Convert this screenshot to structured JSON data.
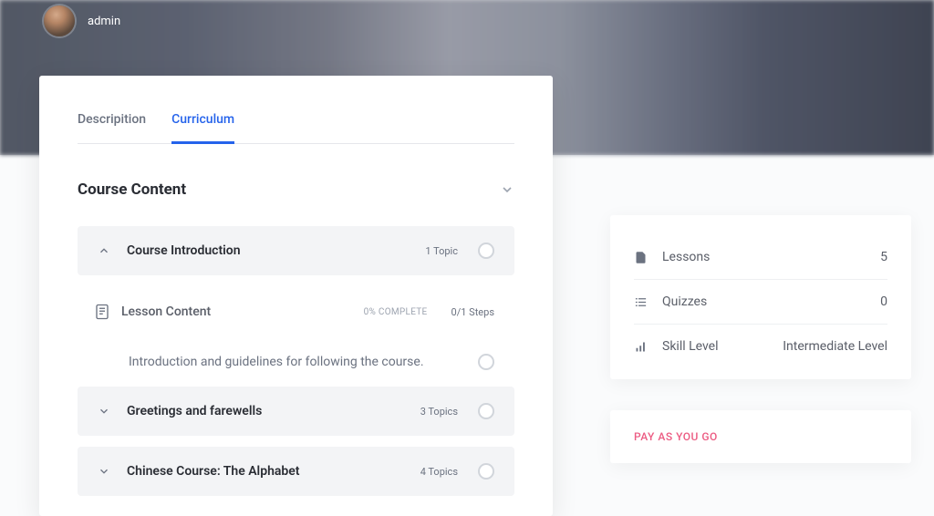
{
  "author": {
    "name": "admin"
  },
  "tabs": {
    "description": "Descripition",
    "curriculum": "Curriculum"
  },
  "course_content": {
    "heading": "Course Content",
    "sections": [
      {
        "title": "Course Introduction",
        "meta": "1 Topic",
        "expanded": true
      },
      {
        "title": "Greetings and farewells",
        "meta": "3 Topics",
        "expanded": false
      },
      {
        "title": "Chinese Course: The Alphabet",
        "meta": "4 Topics",
        "expanded": false
      }
    ],
    "lesson": {
      "title": "Lesson Content",
      "progress": "0% COMPLETE",
      "steps": "0/1 Steps",
      "item_text": "Introduction and guidelines for following the course."
    }
  },
  "info": {
    "lessons": {
      "label": "Lessons",
      "value": "5"
    },
    "quizzes": {
      "label": "Quizzes",
      "value": "0"
    },
    "skill": {
      "label": "Skill Level",
      "value": "Intermediate Level"
    }
  },
  "pricing": {
    "heading": "PAY AS YOU GO"
  }
}
